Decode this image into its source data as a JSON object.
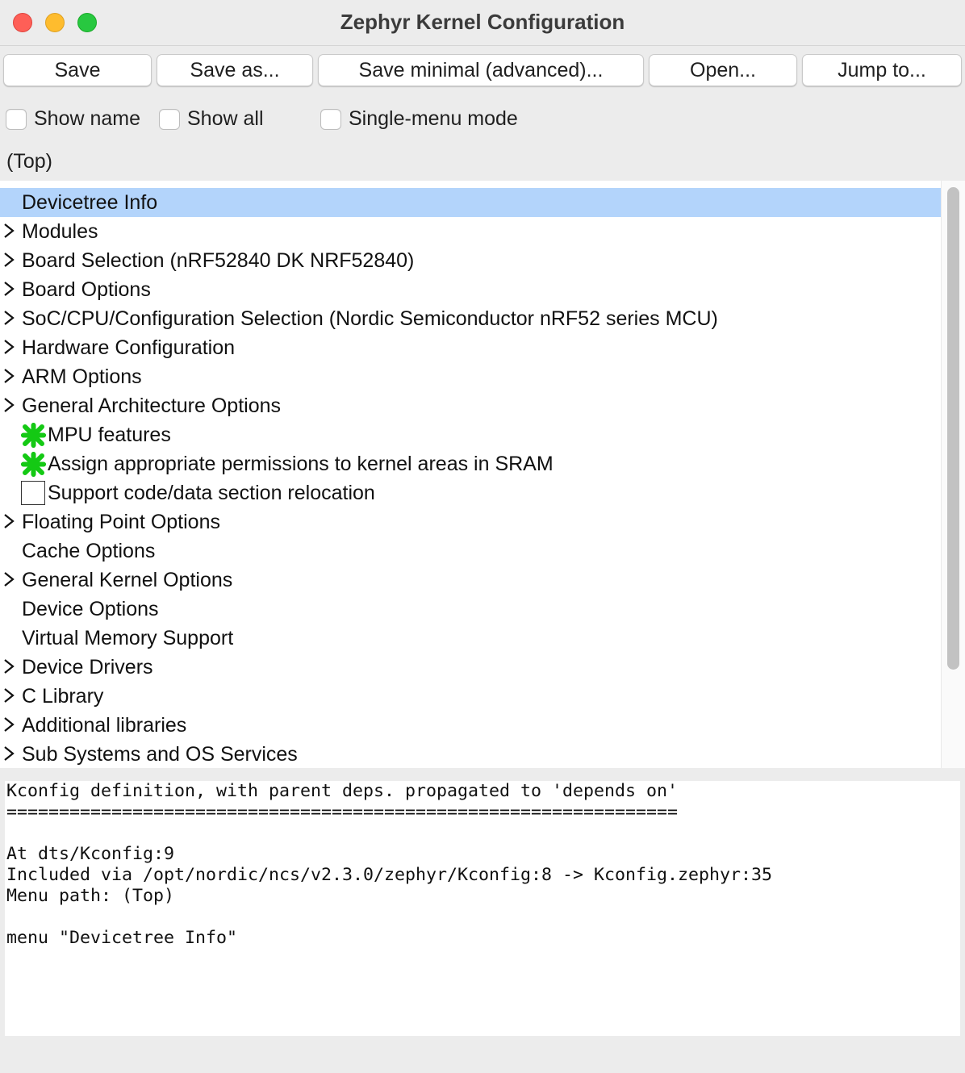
{
  "window": {
    "title": "Zephyr Kernel Configuration"
  },
  "toolbar": {
    "buttons": [
      {
        "label": "Save"
      },
      {
        "label": "Save as..."
      },
      {
        "label": "Save minimal (advanced)..."
      },
      {
        "label": "Open..."
      },
      {
        "label": "Jump to..."
      }
    ]
  },
  "options": {
    "show_name": {
      "label": "Show name",
      "checked": false
    },
    "show_all": {
      "label": "Show all",
      "checked": false
    },
    "single_menu": {
      "label": "Single-menu mode",
      "checked": false
    }
  },
  "current_menu": "(Top)",
  "tree": {
    "items": [
      {
        "label": "Devicetree Info",
        "expandable": false,
        "selected": true
      },
      {
        "label": "Modules",
        "expandable": true
      },
      {
        "label": "Board Selection (nRF52840 DK NRF52840)",
        "expandable": true
      },
      {
        "label": "Board Options",
        "expandable": true
      },
      {
        "label": "SoC/CPU/Configuration Selection (Nordic Semiconductor nRF52 series MCU)",
        "expandable": true
      },
      {
        "label": "Hardware Configuration",
        "expandable": true
      },
      {
        "label": "ARM Options",
        "expandable": true
      },
      {
        "label": "General Architecture Options",
        "expandable": true
      },
      {
        "label": "MPU features",
        "icon": "checked-locked-icon"
      },
      {
        "label": "Assign appropriate permissions to kernel areas in SRAM",
        "icon": "checked-locked-icon"
      },
      {
        "label": "Support code/data section relocation",
        "icon": "unchecked-box-icon"
      },
      {
        "label": "Floating Point Options",
        "expandable": true
      },
      {
        "label": "Cache Options",
        "expandable": false
      },
      {
        "label": "General Kernel Options",
        "expandable": true
      },
      {
        "label": "Device Options",
        "expandable": false
      },
      {
        "label": "Virtual Memory Support",
        "expandable": false
      },
      {
        "label": "Device Drivers",
        "expandable": true
      },
      {
        "label": "C Library",
        "expandable": true
      },
      {
        "label": "Additional libraries",
        "expandable": true
      },
      {
        "label": "Sub Systems and OS Services",
        "expandable": true
      }
    ]
  },
  "info_panel": {
    "lines": [
      "Kconfig definition, with parent deps. propagated to 'depends on'",
      "================================================================",
      "",
      "At dts/Kconfig:9",
      "Included via /opt/nordic/ncs/v2.3.0/zephyr/Kconfig:8 -> Kconfig.zephyr:35",
      "Menu path: (Top)",
      "",
      "menu \"Devicetree Info\""
    ]
  },
  "colors": {
    "selection": "#b3d4fb",
    "locked_check": "#14c914"
  }
}
